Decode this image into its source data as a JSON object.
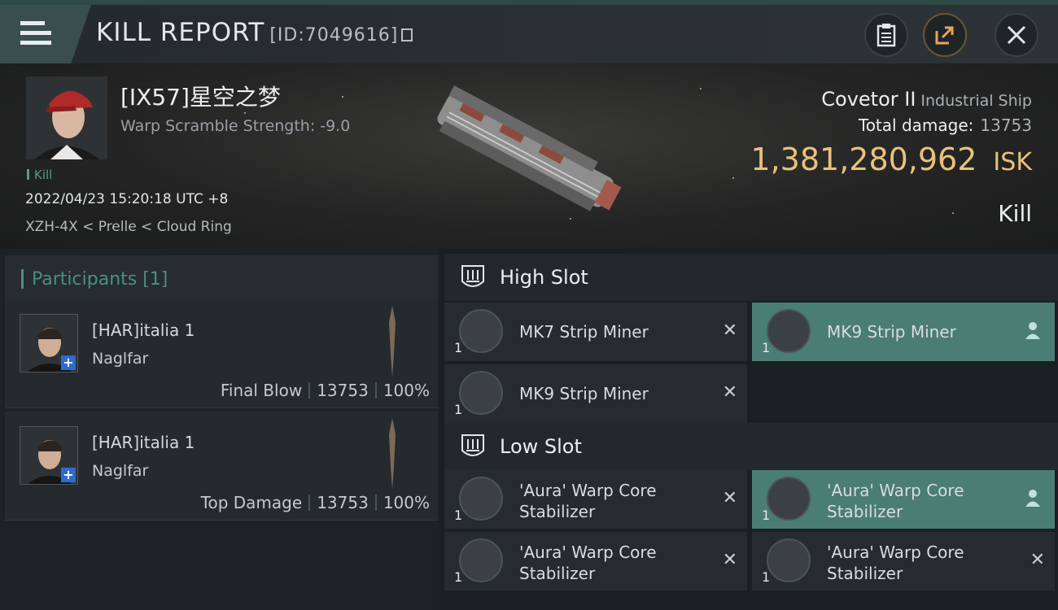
{
  "header": {
    "title": "KILL REPORT",
    "id_label": "[ID:7049616]"
  },
  "victim": {
    "name": "[IX57]星空之梦",
    "warp_scramble": "Warp Scramble Strength: -9.0",
    "kill_tag": "Kill",
    "datetime": "2022/04/23 15:20:18 UTC +8",
    "location": "XZH-4X < Prelle < Cloud Ring"
  },
  "ship": {
    "name": "Covetor II",
    "class": "Industrial Ship",
    "total_damage_label": "Total damage:",
    "total_damage": "13753",
    "isk_value": "1,381,280,962",
    "isk_unit": "ISK",
    "result": "Kill"
  },
  "participants": {
    "title": "Participants [1]",
    "rows": [
      {
        "name": "[HAR]italia 1",
        "ship": "Naglfar",
        "role": "Final Blow",
        "damage": "13753",
        "percent": "100%"
      },
      {
        "name": "[HAR]italia 1",
        "ship": "Naglfar",
        "role": "Top Damage",
        "damage": "13753",
        "percent": "100%"
      }
    ]
  },
  "slots": {
    "high": {
      "title": "High Slot",
      "items": [
        {
          "name": "MK7 Strip Miner",
          "qty": "1",
          "status": "destroyed"
        },
        {
          "name": "MK9 Strip Miner",
          "qty": "1",
          "status": "dropped"
        },
        {
          "name": "MK9 Strip Miner",
          "qty": "1",
          "status": "destroyed"
        }
      ]
    },
    "low": {
      "title": "Low Slot",
      "items": [
        {
          "name": "'Aura' Warp Core Stabilizer",
          "qty": "1",
          "status": "destroyed"
        },
        {
          "name": "'Aura' Warp Core Stabilizer",
          "qty": "1",
          "status": "dropped"
        },
        {
          "name": "'Aura' Warp Core Stabilizer",
          "qty": "1",
          "status": "destroyed"
        },
        {
          "name": "'Aura' Warp Core Stabilizer",
          "qty": "1",
          "status": "destroyed"
        }
      ]
    }
  },
  "colors": {
    "accent_teal": "#4a8f82",
    "isk_gold": "#e8c27a",
    "dropped_highlight": "#4a7d73"
  },
  "icons": [
    "menu-icon",
    "clipboard-icon",
    "share-icon",
    "close-icon",
    "copy-icon",
    "slot-icon",
    "destroyed-x-icon",
    "person-icon"
  ]
}
